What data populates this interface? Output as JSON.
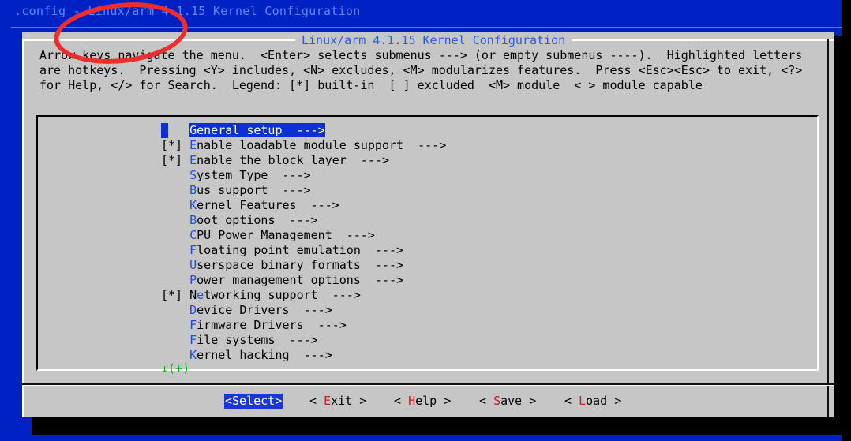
{
  "titlebar": {
    "config_file": ".config",
    "separator": " - ",
    "title": "Linux/arm 4.1.15 Kernel Configuration"
  },
  "dialog": {
    "title": "Linux/arm 4.1.15 Kernel Configuration",
    "help_lines": [
      "Arrow keys navigate the menu.  <Enter> selects submenus ---> (or empty submenus ----).  Highlighted letters",
      "are hotkeys.  Pressing <Y> includes, <N> excludes, <M> modularizes features.  Press <Esc><Esc> to exit, <?>",
      "for Help, </> for Search.  Legend: [*] built-in  [ ] excluded  <M> module  < > module capable"
    ]
  },
  "menu": {
    "items": [
      {
        "state": "",
        "hotkey": "G",
        "rest": "eneral setup  --->",
        "selected": true
      },
      {
        "state": "[*] ",
        "hotkey": "E",
        "rest": "nable loadable module support  --->"
      },
      {
        "state": "[*] ",
        "hotkey": "E",
        "rest": "nable the block layer  --->"
      },
      {
        "state": "    ",
        "hotkey": "S",
        "rest": "ystem Type  --->"
      },
      {
        "state": "    ",
        "hotkey": "B",
        "rest": "us support  --->"
      },
      {
        "state": "    ",
        "hotkey": "K",
        "rest": "ernel Features  --->"
      },
      {
        "state": "    ",
        "hotkey": "B",
        "rest": "oot options  --->"
      },
      {
        "state": "    ",
        "hotkey": "C",
        "rest": "PU Power Management  --->"
      },
      {
        "state": "    ",
        "hotkey": "F",
        "rest": "loating point emulation  --->"
      },
      {
        "state": "    ",
        "hotkey": "U",
        "rest": "serspace binary formats  --->"
      },
      {
        "state": "    ",
        "hotkey": "P",
        "rest": "ower management options  --->"
      },
      {
        "state": "[*] ",
        "pre": "N",
        "hotkey": "e",
        "rest": "tworking support  --->"
      },
      {
        "state": "    ",
        "hotkey": "D",
        "rest": "evice Drivers  --->"
      },
      {
        "state": "    ",
        "hotkey": "F",
        "rest": "irmware Drivers  --->"
      },
      {
        "state": "    ",
        "hotkey": "F",
        "rest": "ile systems  --->"
      },
      {
        "state": "    ",
        "hotkey": "K",
        "rest": "ernel hacking  --->"
      }
    ],
    "scroll_indicator": "↓(+)"
  },
  "buttons": [
    {
      "label": "<Select>",
      "active": true
    },
    {
      "pre": "< ",
      "hotkey": "E",
      "rest": "xit >"
    },
    {
      "pre": "< ",
      "hotkey": "H",
      "rest": "elp >"
    },
    {
      "pre": "< ",
      "hotkey": "S",
      "rest": "ave >"
    },
    {
      "pre": "< ",
      "hotkey": "L",
      "rest": "oad >"
    }
  ],
  "colors": {
    "background": "#0022c4",
    "dialog": "#c6c6c6",
    "highlight": "#0f2fd1",
    "hotkey_menu": "#1f4de0",
    "hotkey_button": "#c21f1f",
    "annotation": "#ee2d2d"
  }
}
